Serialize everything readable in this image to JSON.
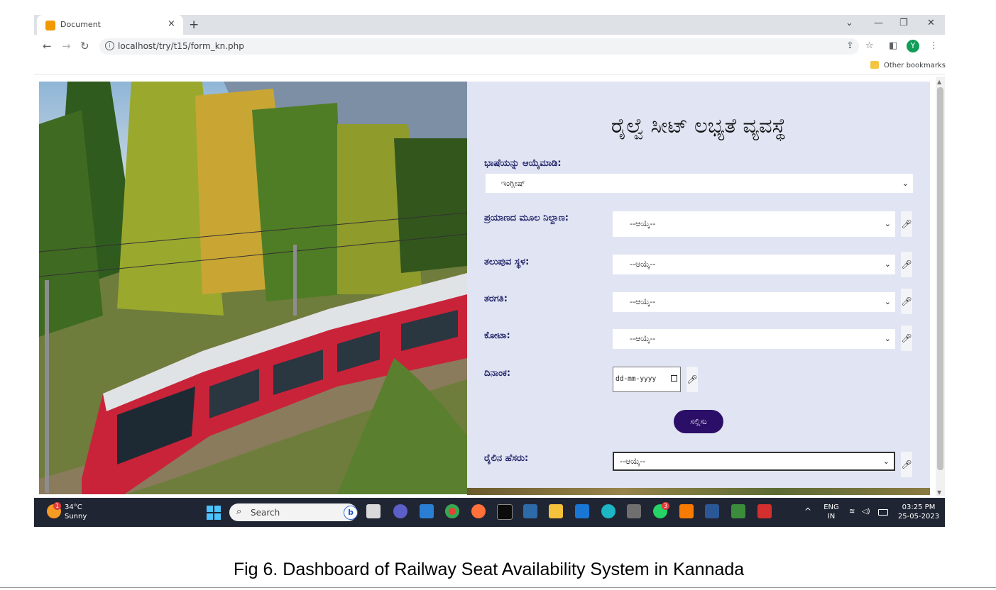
{
  "browser": {
    "tab_title": "Document",
    "tab_close": "×",
    "new_tab": "+",
    "url": "localhost/try/t15/form_kn.php",
    "bookmarks_folder": "Other bookmarks",
    "profile_initial": "Y"
  },
  "form": {
    "title": "ರೈಲ್ವೆ ಸೀಟ್ ಲಭ್ಯತೆ ವ್ಯವಸ್ಥೆ",
    "language": {
      "label": "ಭಾಷೆಯನ್ನು ಆಯ್ಕೆಮಾಡಿ:",
      "value": "ಇಂಗ್ಲೀಷ್"
    },
    "fields": [
      {
        "label": "ಪ್ರಯಾಣದ ಮೂಲ ನಿಲ್ದಾಣ:",
        "value": "--ಆಯ್ಕೆ--"
      },
      {
        "label": "ತಲುಪುವ ಸ್ಥಳ:",
        "value": "--ಆಯ್ಕೆ--"
      },
      {
        "label": "ತರಗತಿ:",
        "value": "--ಆಯ್ಕೆ--"
      },
      {
        "label": "ಕೋಟಾ:",
        "value": "--ಆಯ್ಕೆ--"
      }
    ],
    "date": {
      "label": "ದಿನಾಂಕ:",
      "placeholder": "dd-mm-yyyy"
    },
    "submit_label": "ಸಲ್ಲಿಸು",
    "train_name": {
      "label": "ರೈಲಿನ ಹೆಸರು:",
      "value": "--ಆಯ್ಕೆ--"
    }
  },
  "taskbar": {
    "temperature": "34°C",
    "weather": "Sunny",
    "weather_badge": "1",
    "search_placeholder": "Search",
    "language_line1": "ENG",
    "language_line2": "IN",
    "time": "03:25 PM",
    "date": "25-05-2023",
    "whatsapp_badge": "3"
  },
  "caption": "Fig 6. Dashboard of Railway Seat Availability System in Kannada",
  "colors": {
    "form_panel_bg": "#e1e5f3",
    "label_color": "#1e2066",
    "submit_bg": "#2b0e68",
    "taskbar_bg": "#202533"
  }
}
